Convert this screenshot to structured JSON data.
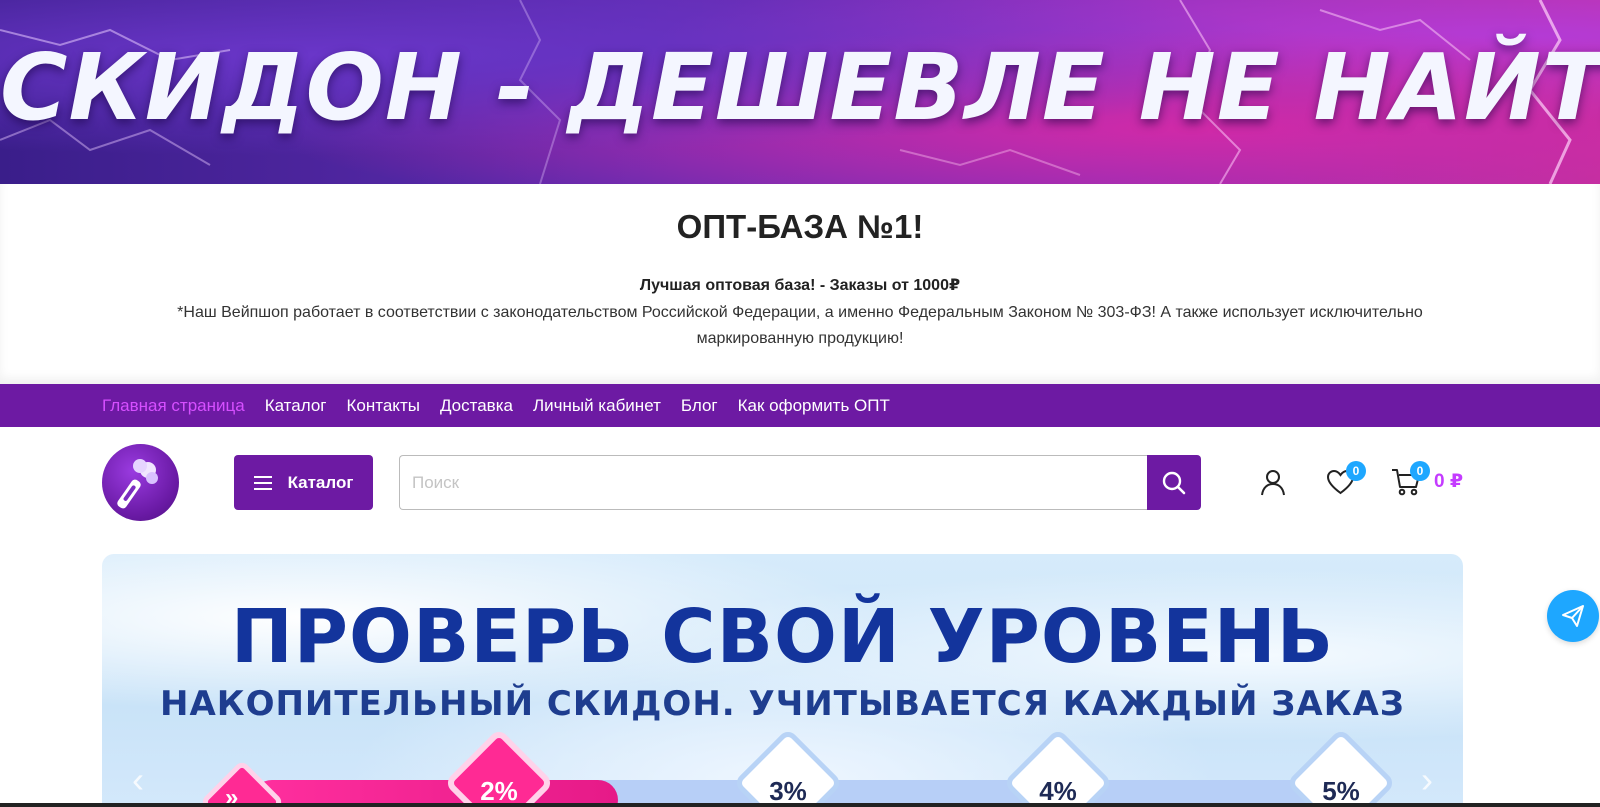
{
  "top_banner": {
    "headline": "СКИДОН - ДЕШЕВЛЕ НЕ НАЙТИ"
  },
  "intro": {
    "heading": "ОПТ-БАЗА №1!",
    "tagline": "Лучшая оптовая база! - Заказы от 1000₽",
    "note": "*Наш Вейпшоп работает в соответствии с законодательством Российской Федерации, а именно Федеральным Законом  № 303-ФЗ! А также использует исключительно маркированную продукцию!"
  },
  "nav": {
    "items": [
      {
        "label": "Главная страница",
        "active": true
      },
      {
        "label": "Каталог",
        "active": false
      },
      {
        "label": "Контакты",
        "active": false
      },
      {
        "label": "Доставка",
        "active": false
      },
      {
        "label": "Личный кабинет",
        "active": false
      },
      {
        "label": "Блог",
        "active": false
      },
      {
        "label": "Как оформить ОПТ",
        "active": false
      }
    ]
  },
  "header": {
    "catalog_button": "Каталог",
    "search_placeholder": "Поиск",
    "search_value": "",
    "wishlist_count": "0",
    "cart_count": "0",
    "cart_total": "0 ₽",
    "icons": [
      "logo-icon",
      "menu-icon",
      "search-icon",
      "user-icon",
      "heart-icon",
      "cart-icon",
      "telegram-icon"
    ]
  },
  "promo": {
    "title": "ПРОВЕРЬ СВОЙ УРОВЕНЬ",
    "subtitle": "НАКОПИТЕЛЬНЫЙ СКИДОН. УЧИТЫВАЕТСЯ КАЖДЫЙ ЗАКАЗ",
    "start_symbol": "»",
    "levels": [
      "2%",
      "3%",
      "4%",
      "5%"
    ],
    "active_level": "2%",
    "progress": 0.33
  },
  "colors": {
    "brand_purple": "#6d1aa3",
    "nav_active": "#d64fff",
    "accent_pink": "#ff2a94",
    "badge_blue": "#1ea7ff",
    "promo_navy": "#13349c"
  }
}
